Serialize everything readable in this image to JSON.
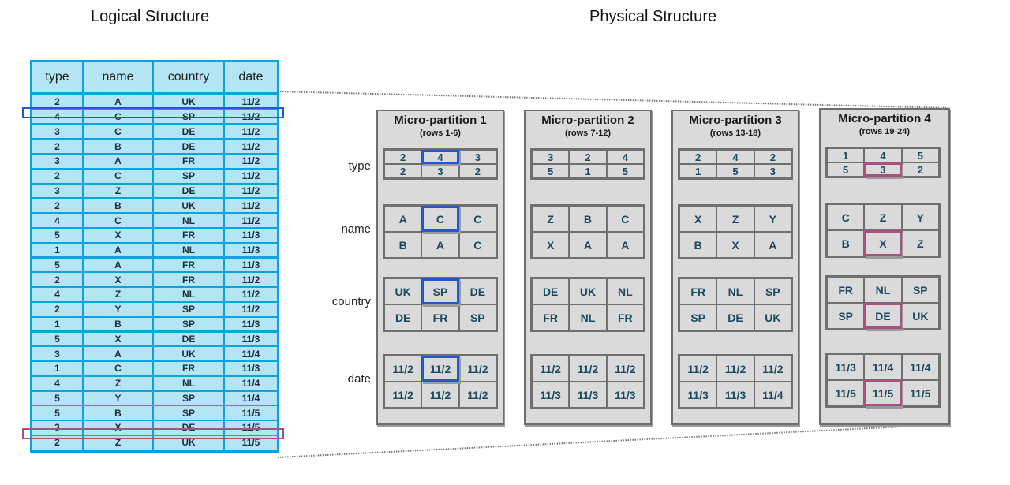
{
  "titles": {
    "logical": "Logical Structure",
    "physical": "Physical Structure"
  },
  "logical_table": {
    "columns": [
      "type",
      "name",
      "country",
      "date"
    ],
    "rows": [
      [
        "2",
        "A",
        "UK",
        "11/2"
      ],
      [
        "4",
        "C",
        "SP",
        "11/2"
      ],
      [
        "3",
        "C",
        "DE",
        "11/2"
      ],
      [
        "2",
        "B",
        "DE",
        "11/2"
      ],
      [
        "3",
        "A",
        "FR",
        "11/2"
      ],
      [
        "2",
        "C",
        "SP",
        "11/2"
      ],
      [
        "3",
        "Z",
        "DE",
        "11/2"
      ],
      [
        "2",
        "B",
        "UK",
        "11/2"
      ],
      [
        "4",
        "C",
        "NL",
        "11/2"
      ],
      [
        "5",
        "X",
        "FR",
        "11/3"
      ],
      [
        "1",
        "A",
        "NL",
        "11/3"
      ],
      [
        "5",
        "A",
        "FR",
        "11/3"
      ],
      [
        "2",
        "X",
        "FR",
        "11/2"
      ],
      [
        "4",
        "Z",
        "NL",
        "11/2"
      ],
      [
        "2",
        "Y",
        "SP",
        "11/2"
      ],
      [
        "1",
        "B",
        "SP",
        "11/3"
      ],
      [
        "5",
        "X",
        "DE",
        "11/3"
      ],
      [
        "3",
        "A",
        "UK",
        "11/4"
      ],
      [
        "1",
        "C",
        "FR",
        "11/3"
      ],
      [
        "4",
        "Z",
        "NL",
        "11/4"
      ],
      [
        "5",
        "Y",
        "SP",
        "11/4"
      ],
      [
        "5",
        "B",
        "SP",
        "11/5"
      ],
      [
        "3",
        "X",
        "DE",
        "11/5"
      ],
      [
        "2",
        "Z",
        "UK",
        "11/5"
      ]
    ],
    "highlighted_rows": [
      {
        "row_number": 2,
        "color": "#1d59d4"
      },
      {
        "row_number": 23,
        "color": "#a9507e"
      }
    ]
  },
  "row_labels": [
    "type",
    "name",
    "country",
    "date"
  ],
  "partitions": [
    {
      "title": "Micro-partition 1",
      "rows": "(rows 1-6)",
      "type": [
        "2",
        "4",
        "3",
        "2",
        "3",
        "2"
      ],
      "name": [
        "A",
        "C",
        "C",
        "B",
        "A",
        "C"
      ],
      "country": [
        "UK",
        "SP",
        "DE",
        "DE",
        "FR",
        "SP"
      ],
      "date": [
        "11/2",
        "11/2",
        "11/2",
        "11/2",
        "11/2",
        "11/2"
      ],
      "highlight_index": 1,
      "highlight_color": "blue"
    },
    {
      "title": "Micro-partition 2",
      "rows": "(rows 7-12)",
      "type": [
        "3",
        "2",
        "4",
        "5",
        "1",
        "5"
      ],
      "name": [
        "Z",
        "B",
        "C",
        "X",
        "A",
        "A"
      ],
      "country": [
        "DE",
        "UK",
        "NL",
        "FR",
        "NL",
        "FR"
      ],
      "date": [
        "11/2",
        "11/2",
        "11/2",
        "11/3",
        "11/3",
        "11/3"
      ],
      "highlight_index": null,
      "highlight_color": null
    },
    {
      "title": "Micro-partition 3",
      "rows": "(rows 13-18)",
      "type": [
        "2",
        "4",
        "2",
        "1",
        "5",
        "3"
      ],
      "name": [
        "X",
        "Z",
        "Y",
        "B",
        "X",
        "A"
      ],
      "country": [
        "FR",
        "NL",
        "SP",
        "SP",
        "DE",
        "UK"
      ],
      "date": [
        "11/2",
        "11/2",
        "11/2",
        "11/3",
        "11/3",
        "11/4"
      ],
      "highlight_index": null,
      "highlight_color": null
    },
    {
      "title": "Micro-partition 4",
      "rows": "(rows 19-24)",
      "type": [
        "1",
        "4",
        "5",
        "5",
        "3",
        "2"
      ],
      "name": [
        "C",
        "Z",
        "Y",
        "B",
        "X",
        "Z"
      ],
      "country": [
        "FR",
        "NL",
        "SP",
        "SP",
        "DE",
        "UK"
      ],
      "date": [
        "11/3",
        "11/4",
        "11/4",
        "11/5",
        "11/5",
        "11/5"
      ],
      "highlight_index": 4,
      "highlight_color": "pink"
    }
  ]
}
